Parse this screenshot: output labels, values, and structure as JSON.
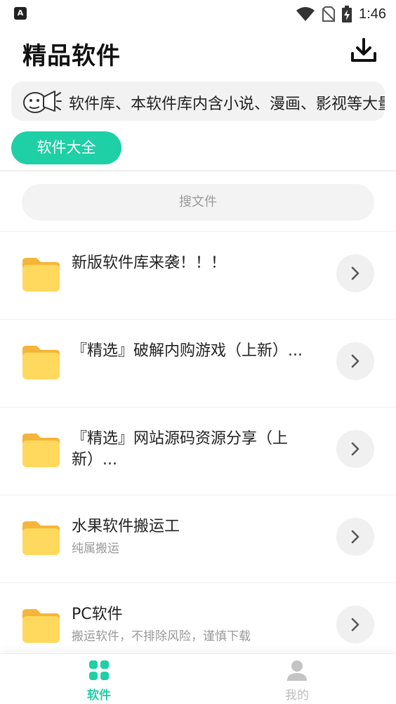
{
  "status_bar": {
    "time": "1:46",
    "left_icon_letter": "A"
  },
  "header": {
    "title": "精品软件"
  },
  "notice": {
    "text": "软件库、本软件库内含小说、漫画、影视等大量"
  },
  "category": {
    "label": "软件大全"
  },
  "search": {
    "placeholder": "搜文件"
  },
  "list": [
    {
      "title": "新版软件库来袭！！！",
      "subtitle": ""
    },
    {
      "title": "『精选』破解内购游戏（上新）...",
      "subtitle": ""
    },
    {
      "title": "『精选』网站源码资源分享（上新）...",
      "subtitle": ""
    },
    {
      "title": "水果软件搬运工",
      "subtitle": "纯属搬运"
    },
    {
      "title": "PC软件",
      "subtitle": "搬运软件，不排除风险，谨慎下载"
    }
  ],
  "nav": {
    "software_label": "软件",
    "mine_label": "我的"
  },
  "colors": {
    "accent": "#1fcfa6",
    "folder": "#ffd95e",
    "folder_tab": "#f5b53a",
    "inactive": "#bdbdbd"
  }
}
